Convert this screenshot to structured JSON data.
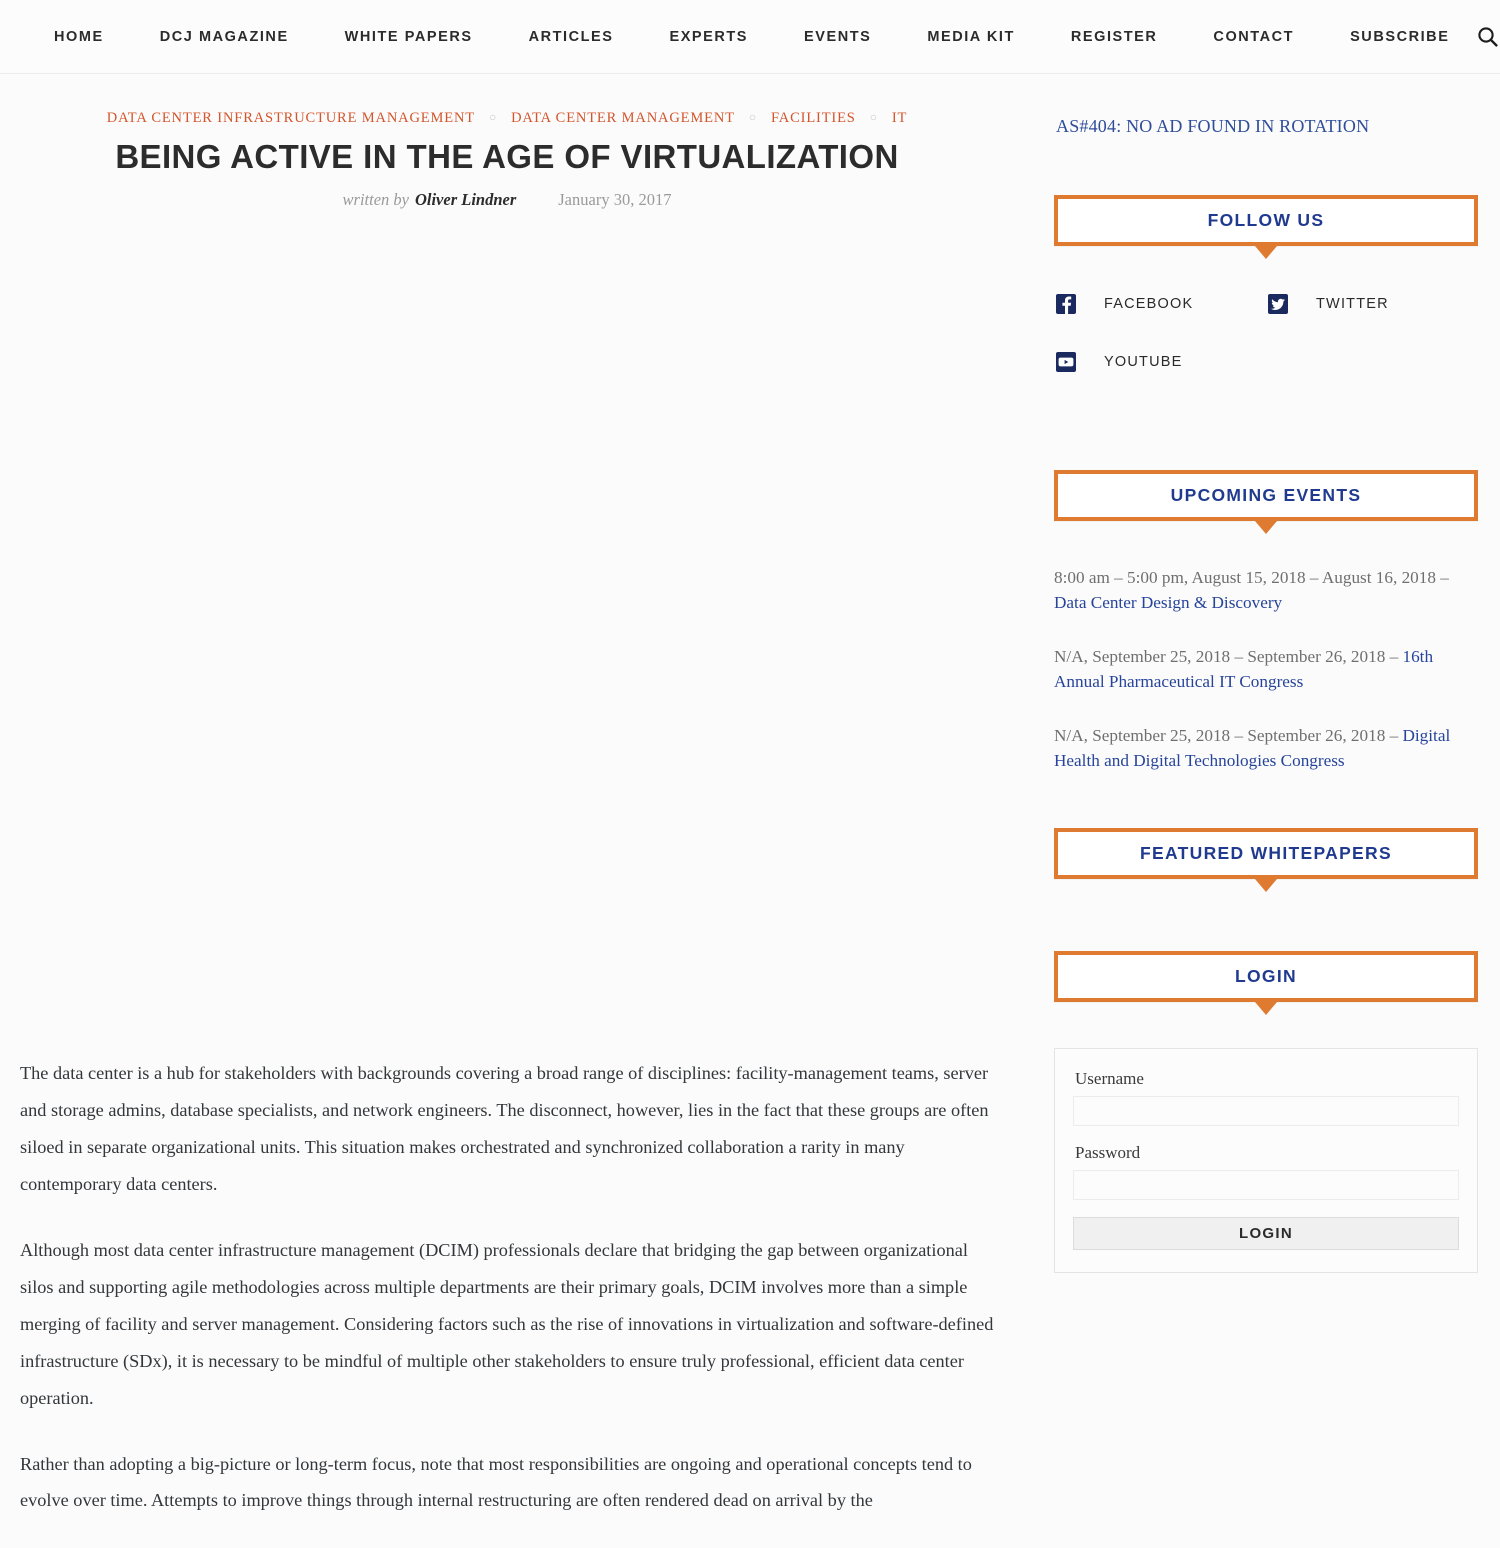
{
  "nav": {
    "items": [
      {
        "label": "HOME"
      },
      {
        "label": "DCJ MAGAZINE"
      },
      {
        "label": "WHITE PAPERS"
      },
      {
        "label": "ARTICLES"
      },
      {
        "label": "EXPERTS"
      },
      {
        "label": "EVENTS"
      },
      {
        "label": "MEDIA KIT"
      },
      {
        "label": "REGISTER"
      },
      {
        "label": "CONTACT"
      },
      {
        "label": "SUBSCRIBE"
      }
    ],
    "search_icon": "search-icon"
  },
  "article": {
    "breadcrumb": [
      "DATA CENTER INFRASTRUCTURE MANAGEMENT",
      "DATA CENTER MANAGEMENT",
      "FACILITIES",
      "IT"
    ],
    "breadcrumb_separator": "○",
    "title": "BEING ACTIVE IN THE AGE OF VIRTUALIZATION",
    "written_by_label": "written by",
    "author": "Oliver Lindner",
    "date": "January 30, 2017",
    "paragraphs": [
      "The data center is a hub for stakeholders with backgrounds covering a broad range of disciplines: facility-management teams, server and storage admins, database specialists, and network engineers. The disconnect, however, lies in the fact that these groups are often siloed in separate organizational units. This situation makes orchestrated and synchronized collaboration a rarity in many contemporary data centers.",
      "Although most data center infrastructure management (DCIM) professionals declare that bridging the gap between organizational silos and supporting agile methodologies across multiple departments are their primary goals, DCIM involves more than a simple merging of facility and server management. Considering factors such as the rise of innovations in virtualization and software-defined infrastructure (SDx), it is necessary to be mindful of multiple other stakeholders to ensure truly professional, efficient data center operation.",
      "Rather than adopting a big-picture or long-term focus, note that most responsibilities are ongoing and operational concepts tend to evolve over time. Attempts to improve things through internal restructuring are often rendered dead on arrival by the"
    ]
  },
  "sidebar": {
    "ad_notice": "AS#404: NO AD FOUND IN ROTATION",
    "follow_us": {
      "title": "FOLLOW US",
      "links": [
        {
          "label": "FACEBOOK",
          "icon": "facebook-icon"
        },
        {
          "label": "TWITTER",
          "icon": "twitter-icon"
        },
        {
          "label": "YOUTUBE",
          "icon": "youtube-icon"
        }
      ]
    },
    "upcoming_events": {
      "title": "UPCOMING EVENTS",
      "items": [
        {
          "meta": "8:00 am – 5:00 pm, August 15, 2018 – August 16, 2018 – ",
          "link": "Data Center Design & Discovery"
        },
        {
          "meta": "N/A, September 25, 2018 – September 26, 2018 – ",
          "link": "16th Annual Pharmaceutical IT Congress"
        },
        {
          "meta": "N/A, September 25, 2018 – September 26, 2018 – ",
          "link": "Digital Health and Digital Technologies Congress"
        }
      ]
    },
    "featured_whitepapers": {
      "title": "FEATURED WHITEPAPERS"
    },
    "login": {
      "title": "LOGIN",
      "username_label": "Username",
      "username_value": "",
      "password_label": "Password",
      "password_value": "",
      "submit_label": "LOGIN"
    }
  },
  "colors": {
    "accent_orange": "#de7b30",
    "heading_blue": "#203a8f",
    "link_blue": "#27449b",
    "breadcrumb_orange": "#d4552b",
    "body_text": "#33373a"
  }
}
